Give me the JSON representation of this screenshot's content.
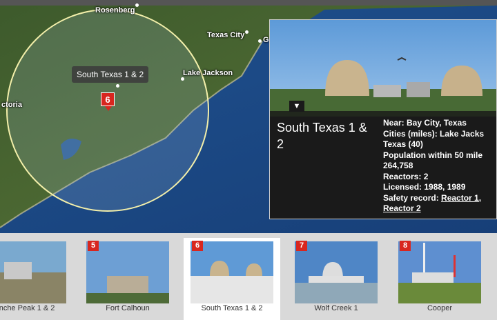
{
  "map": {
    "cities": [
      "Rosenberg",
      "Texas City",
      "G",
      "Lake Jackson",
      "ctoria"
    ],
    "site_tooltip": "South Texas 1 & 2",
    "marker_number": "6"
  },
  "panel": {
    "name": "South Texas 1 & 2",
    "near": "Near: Bay City, Texas",
    "cities_line1": "Cities (miles): Lake Jacks",
    "cities_line2": "Texas (40)",
    "population_label": "Population within 50 mile",
    "population_value": "264,758",
    "reactors": "Reactors: 2",
    "licensed": "Licensed: 1988, 1989",
    "safety_label": "Safety record: ",
    "safety_link1": "Reactor 1,",
    "safety_link2": "Reactor 2"
  },
  "thumbnails": [
    {
      "num": "",
      "caption": "anche Peak 1 & 2"
    },
    {
      "num": "5",
      "caption": "Fort Calhoun"
    },
    {
      "num": "6",
      "caption": "South Texas 1 & 2"
    },
    {
      "num": "7",
      "caption": "Wolf Creek 1"
    },
    {
      "num": "8",
      "caption": "Cooper"
    }
  ],
  "colors": {
    "marker": "#d8261f",
    "radius_ring": "#f3efaa",
    "sea": "#1c4a86"
  }
}
